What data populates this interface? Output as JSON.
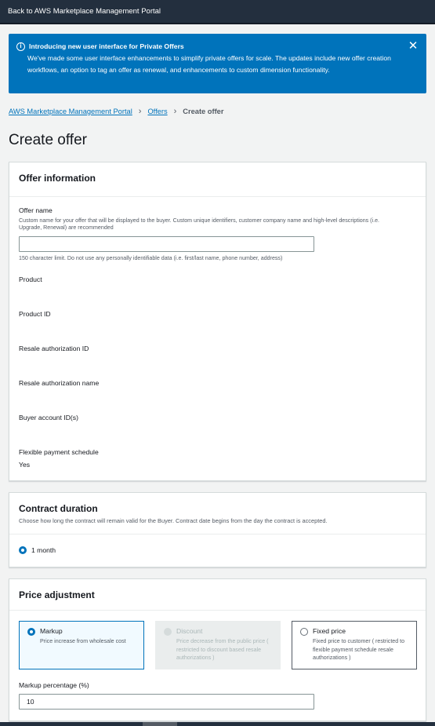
{
  "topbar": {
    "back_link": "Back to AWS Marketplace Management Portal"
  },
  "banner": {
    "title": "Introducing new user interface for Private Offers",
    "body": "We've made some user interface enhancements to simplify private offers for scale. The updates include new offer creation workflows, an option to tag an offer as renewal, and enhancements to custom dimension functionality.",
    "icon": "info-icon",
    "close_icon": "close-icon",
    "color": "#0073bb"
  },
  "breadcrumb": {
    "items": [
      "AWS Marketplace Management Portal",
      "Offers"
    ],
    "current": "Create offer"
  },
  "page_title": "Create offer",
  "offer_information": {
    "title": "Offer information",
    "offer_name": {
      "label": "Offer name",
      "description": "Custom name for your offer that will be displayed to the buyer. Custom unique identifiers, customer company name and high-level descriptions (i.e. Upgrade, Renewal) are recommended",
      "value": "",
      "constraint": "150 character limit. Do not use any personally identifiable data (i.e. first/last name, phone number, address)"
    },
    "product": {
      "label": "Product",
      "value": ""
    },
    "product_id": {
      "label": "Product ID",
      "value": ""
    },
    "resale_authorization_id": {
      "label": "Resale authorization ID",
      "value": ""
    },
    "resale_authorization_name": {
      "label": "Resale authorization name",
      "value": ""
    },
    "buyer_account_ids": {
      "label": "Buyer account ID(s)",
      "value": ""
    },
    "flexible_payment_schedule": {
      "label": "Flexible payment schedule",
      "value": "Yes"
    }
  },
  "contract_duration": {
    "title": "Contract duration",
    "description": "Choose how long the contract will remain valid for the Buyer. Contract date begins from the day the contract is accepted.",
    "option": "1 month",
    "selected": true
  },
  "price_adjustment": {
    "title": "Price adjustment",
    "options": [
      {
        "name": "Markup",
        "description": "Price increase from wholesale cost",
        "state": "selected"
      },
      {
        "name": "Discount",
        "description": "Price decrease from the public price ( restricted to discount based resale authorizations )",
        "state": "disabled"
      },
      {
        "name": "Fixed price",
        "description": "Fixed price to customer ( restricted to flexible payment schedule resale authorizations )",
        "state": "unselected"
      }
    ],
    "markup_percentage": {
      "label": "Markup percentage (%)",
      "value": "10"
    }
  },
  "colors": {
    "topbar": "#232f3e",
    "accent": "#0073bb",
    "background": "#f2f3f3"
  }
}
